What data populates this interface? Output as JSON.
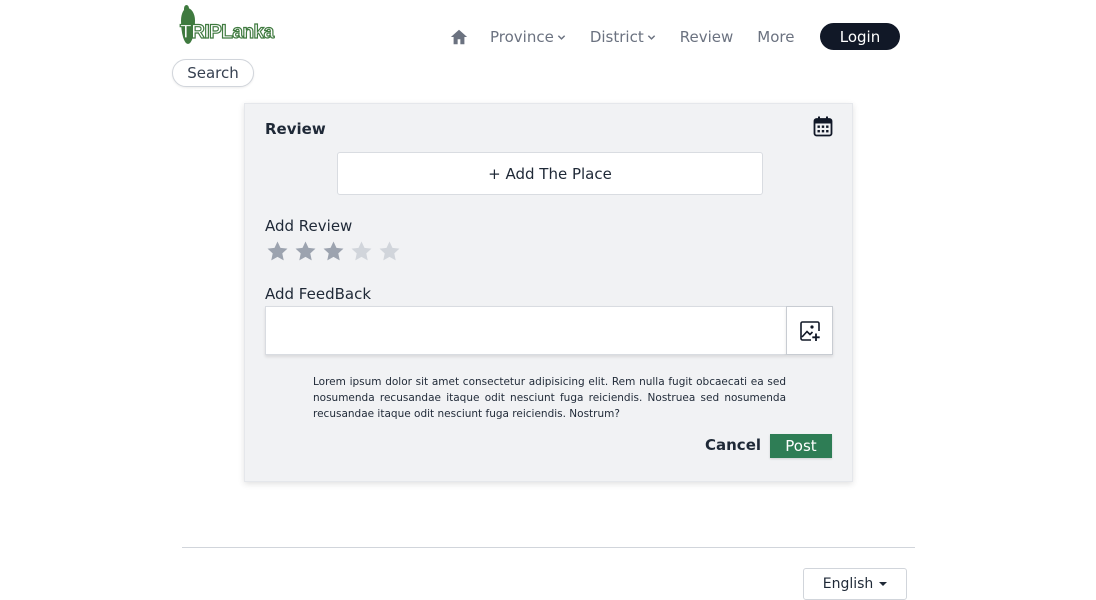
{
  "brand": {
    "logo_text": "TRIPLanka"
  },
  "nav": {
    "home_icon": "home-icon",
    "items": [
      {
        "label": "Province",
        "has_dropdown": true
      },
      {
        "label": "District",
        "has_dropdown": true
      },
      {
        "label": "Review",
        "has_dropdown": false
      },
      {
        "label": "More",
        "has_dropdown": false
      }
    ],
    "login_label": "Login"
  },
  "search": {
    "label": "Search"
  },
  "review_card": {
    "title": "Review",
    "calendar_icon": "calendar-icon",
    "add_place_label": "+ Add The Place",
    "add_review_label": "Add Review",
    "rating": {
      "value": 3,
      "max": 5
    },
    "add_feedback_label": "Add FeedBack",
    "feedback_value": "",
    "image_add_icon": "image-add-icon",
    "note": "Lorem ipsum dolor sit amet consectetur adipisicing elit. Rem nulla fugit obcaecati ea sed nosumenda recusandae itaque odit nesciunt fuga reiciendis. Nostruea sed nosumenda recusandae itaque odit nesciunt fuga reiciendis. Nostrum?",
    "cancel_label": "Cancel",
    "post_label": "Post"
  },
  "footer": {
    "language_label": "English"
  },
  "colors": {
    "brand_green": "#3f7a3f",
    "post_green": "#2e7d55",
    "login_dark": "#111827",
    "star_filled": "#9ca3af",
    "star_empty": "#d1d5db",
    "card_bg": "#f1f2f4"
  }
}
